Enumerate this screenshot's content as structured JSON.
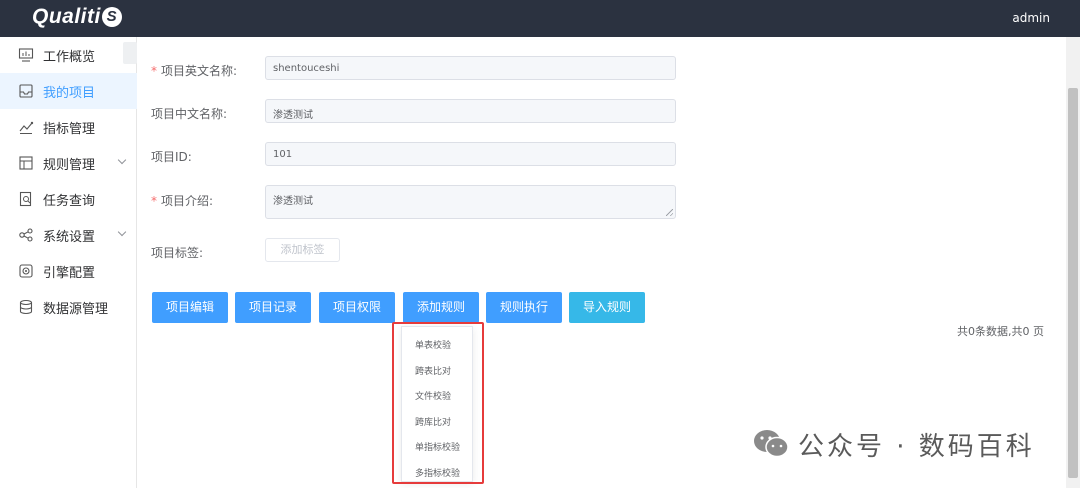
{
  "header": {
    "logo_text": "Qualiti",
    "logo_letter": "S",
    "user": "admin"
  },
  "sidebar": {
    "items": [
      {
        "label": "工作概览",
        "icon": "monitor-icon"
      },
      {
        "label": "我的项目",
        "icon": "inbox-icon",
        "active": true
      },
      {
        "label": "指标管理",
        "icon": "metric-icon"
      },
      {
        "label": "规则管理",
        "icon": "layout-icon",
        "expandable": true
      },
      {
        "label": "任务查询",
        "icon": "document-search-icon"
      },
      {
        "label": "系统设置",
        "icon": "share-nodes-icon",
        "expandable": true
      },
      {
        "label": "引擎配置",
        "icon": "engine-icon"
      },
      {
        "label": "数据源管理",
        "icon": "database-icon"
      }
    ]
  },
  "form": {
    "en_name_label": "项目英文名称:",
    "en_name_value": "shentouceshi",
    "cn_name_label": "项目中文名称:",
    "cn_name_value": "渗透测试",
    "id_label": "项目ID:",
    "id_value": "101",
    "intro_label": "项目介绍:",
    "intro_value": "渗透测试",
    "tags_label": "项目标签:",
    "add_tag_label": "添加标签",
    "required_mark": "*"
  },
  "actions": {
    "edit": "项目编辑",
    "records": "项目记录",
    "permissions": "项目权限",
    "add_rule": "添加规则",
    "run_rule": "规则执行",
    "import_rule": "导入规则"
  },
  "pagination": {
    "summary": "共0条数据,共0 页"
  },
  "add_rule_menu": {
    "items": [
      "单表校验",
      "跨表比对",
      "文件校验",
      "跨库比对",
      "单指标校验",
      "多指标校验"
    ]
  },
  "watermark": {
    "text": "公众号 · 数码百科"
  },
  "colors": {
    "primary": "#409eff",
    "import_button": "#36b8e8",
    "header": "#2b3240",
    "highlight_box": "#e63b3b"
  }
}
